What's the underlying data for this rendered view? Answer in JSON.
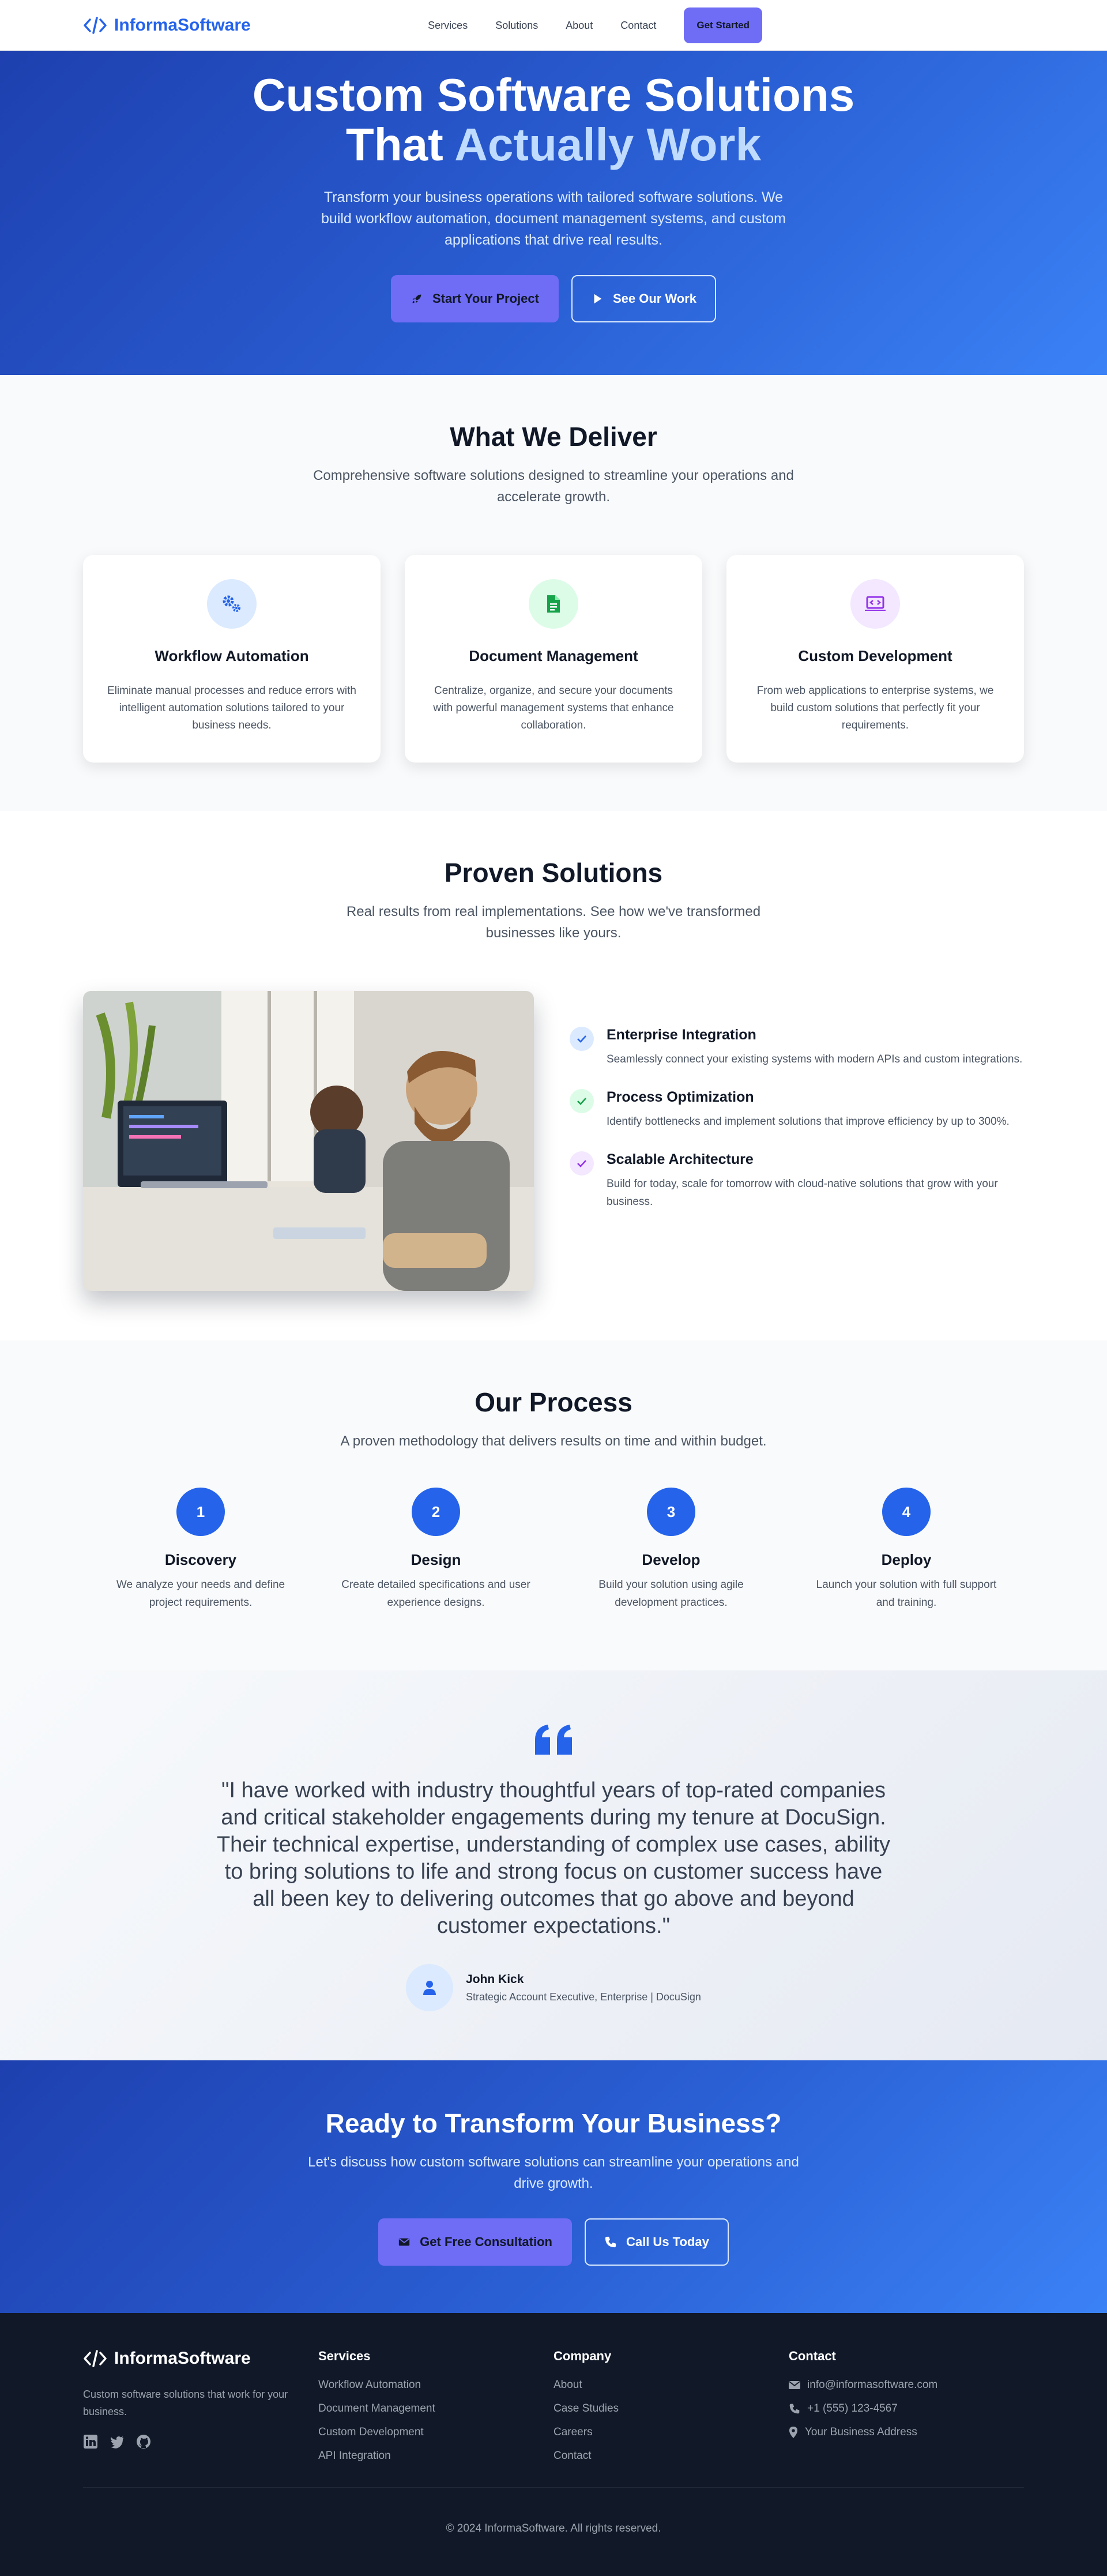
{
  "brand": {
    "name": "InformaSoftware",
    "color": "#2563eb",
    "accent": "#6f6cf6"
  },
  "nav": {
    "links": [
      "Services",
      "Solutions",
      "About",
      "Contact"
    ],
    "cta": "Get Started"
  },
  "hero": {
    "title_line1": "Custom Software Solutions",
    "title_line2_plain": "That",
    "title_line2_accent": "Actually Work",
    "description": "Transform your business operations with tailored software solutions. We build workflow automation, document management systems, and custom applications that drive real results.",
    "primary_button": "Start Your Project",
    "primary_icon": "rocket-icon",
    "secondary_button": "See Our Work",
    "secondary_icon": "play-icon"
  },
  "deliver": {
    "title": "What We Deliver",
    "subtitle": "Comprehensive software solutions designed to streamline your operations and accelerate growth.",
    "cards": [
      {
        "title": "Workflow Automation",
        "text": "Eliminate manual processes and reduce errors with intelligent automation solutions tailored to your business needs.",
        "icon": "gears-icon",
        "color": "#2563eb",
        "bg": "#dbeafe"
      },
      {
        "title": "Document Management",
        "text": "Centralize, organize, and secure your documents with powerful management systems that enhance collaboration.",
        "icon": "document-icon",
        "color": "#16a34a",
        "bg": "#dcfce7"
      },
      {
        "title": "Custom Development",
        "text": "From web applications to enterprise systems, we build custom solutions that perfectly fit your requirements.",
        "icon": "laptop-code-icon",
        "color": "#9333ea",
        "bg": "#f3e8ff"
      }
    ]
  },
  "proven": {
    "title": "Proven Solutions",
    "subtitle": "Real results from real implementations. See how we've transformed businesses like yours.",
    "image": "office-developers-photo",
    "features": [
      {
        "title": "Enterprise Integration",
        "text": "Seamlessly connect your existing systems with modern APIs and custom integrations.",
        "color": "#2563eb",
        "bg": "#dbeafe"
      },
      {
        "title": "Process Optimization",
        "text": "Identify bottlenecks and implement solutions that improve efficiency by up to 300%.",
        "color": "#16a34a",
        "bg": "#dcfce7"
      },
      {
        "title": "Scalable Architecture",
        "text": "Build for today, scale for tomorrow with cloud-native solutions that grow with your business.",
        "color": "#9333ea",
        "bg": "#f3e8ff"
      }
    ]
  },
  "process": {
    "title": "Our Process",
    "subtitle": "A proven methodology that delivers results on time and within budget.",
    "steps": [
      {
        "num": "1",
        "title": "Discovery",
        "text": "We analyze your needs and define project requirements."
      },
      {
        "num": "2",
        "title": "Design",
        "text": "Create detailed specifications and user experience designs."
      },
      {
        "num": "3",
        "title": "Develop",
        "text": "Build your solution using agile development practices."
      },
      {
        "num": "4",
        "title": "Deploy",
        "text": "Launch your solution with full support and training."
      }
    ]
  },
  "testimonial": {
    "quote": "\"I have worked with industry thoughtful years of top-rated companies and critical stakeholder engagements during my tenure at DocuSign. Their technical expertise, understanding of complex use cases, ability to bring solutions to life and strong focus on customer success have all been key to delivering outcomes that go above and beyond customer expectations.\"",
    "name": "John Kick",
    "role": "Strategic Account Executive, Enterprise | DocuSign"
  },
  "cta": {
    "title": "Ready to Transform Your Business?",
    "text": "Let's discuss how custom software solutions can streamline your operations and drive growth.",
    "primary_button": "Get Free Consultation",
    "primary_icon": "envelope-icon",
    "secondary_button": "Call Us Today",
    "secondary_icon": "phone-icon"
  },
  "footer": {
    "tagline": "Custom software solutions that work for your business.",
    "socials": [
      "linkedin-icon",
      "twitter-icon",
      "github-icon"
    ],
    "services_title": "Services",
    "services": [
      "Workflow Automation",
      "Document Management",
      "Custom Development",
      "API Integration"
    ],
    "company_title": "Company",
    "company": [
      "About",
      "Case Studies",
      "Careers",
      "Contact"
    ],
    "contact_title": "Contact",
    "contact": [
      {
        "icon": "envelope-icon",
        "text": "info@informasoftware.com"
      },
      {
        "icon": "phone-icon",
        "text": "+1 (555) 123-4567"
      },
      {
        "icon": "map-pin-icon",
        "text": "Your Business Address"
      }
    ],
    "copyright": "© 2024 InformaSoftware. All rights reserved."
  }
}
